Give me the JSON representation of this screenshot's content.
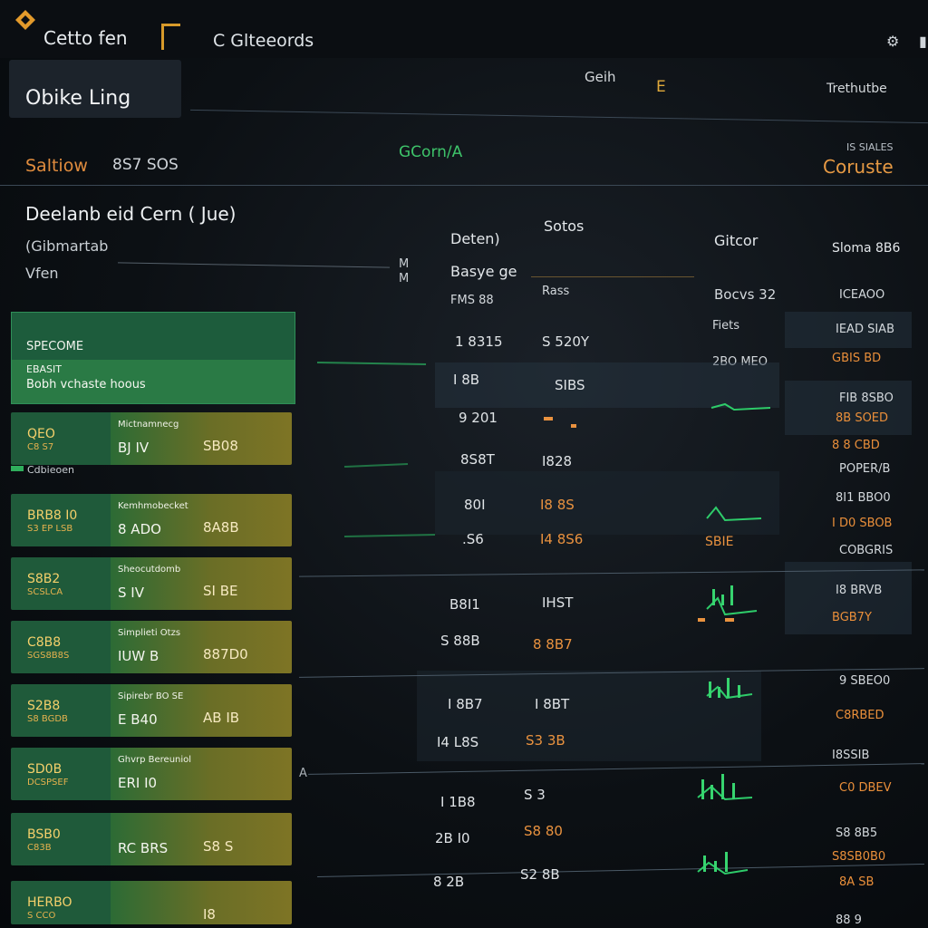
{
  "app": {
    "title": "Cetto fen",
    "nav_tab": "C Glteeords"
  },
  "header": {
    "title": "Obike Ling",
    "center_label": "Geih",
    "center_badge": "E",
    "right_label": "Trethutbe"
  },
  "filters": {
    "label": "Saltiow",
    "value": "8S7 SOS",
    "center": "GCorn/A",
    "right_small": "IS SIALES",
    "right": "Coruste"
  },
  "section": {
    "title": "Deelanb eid Cern ( Jue)",
    "subtitle": "(Gibmartab",
    "view": "Vfen",
    "arrows": [
      "M",
      "M"
    ]
  },
  "columns": {
    "c1_a": "Deten)",
    "c1_b": "Basye ge",
    "c1_c": "FMS 88",
    "c2_a": "Sotos",
    "c2_b": "Rass",
    "c3_a": "Gitcor",
    "c3_b": "Bocvs 32",
    "c3_c": "Fiets",
    "c3_d": "2BO MEO",
    "c4": "Sloma 8B6"
  },
  "hero_card": {
    "label": "SPECOME",
    "sub": "EBASIT",
    "text": "Bobh vchaste hoous"
  },
  "list_cards": [
    {
      "code": "QEO",
      "code2": "C8 S7",
      "desc": "Mictnamnecg",
      "v1": "BJ IV",
      "v2": "SB08"
    },
    {
      "code": "BRB8 I0",
      "code2": "S3 EP LSB",
      "desc": "Kemhmobecket",
      "v1": "8 ADO",
      "v2": "8A8B"
    },
    {
      "code": "S8B2",
      "code2": "SCSLCA",
      "desc": "Sheocutdomb",
      "v1": "S IV",
      "v2": "SI BE"
    },
    {
      "code": "C8B8",
      "code2": "SGS8B8S",
      "desc": "Simplieti Otzs",
      "v1": "IUW B",
      "v2": "887D0"
    },
    {
      "code": "S2B8",
      "code2": "S8 BGDB",
      "desc": "Sipirebr BO SE",
      "v1": "E B40",
      "v2": "AB IB"
    },
    {
      "code": "SD0B",
      "code2": "DCSPSEF",
      "desc": "Ghvrp Bereuniol",
      "v1": "ERI I0",
      "v2": ""
    },
    {
      "code": "BSB0",
      "code2": "C83B",
      "desc": "",
      "v1": "RC BRS",
      "v2": "S8 S"
    },
    {
      "code": "HERBO",
      "code2": "S CCO",
      "desc": "",
      "v1": "",
      "v2": "I8"
    }
  ],
  "list_footer": "Cdbieoen",
  "col_a": [
    "1 8315",
    "I 8B",
    "9 201",
    "8S8T",
    "80I",
    ".S6",
    "B8I1",
    "S 88B",
    "I 8B7",
    "I4 L8S",
    "I 1B8",
    "2B I0",
    "8 2B"
  ],
  "col_b": [
    "S 520Y",
    "SIBS",
    "I828",
    "I8 8S",
    "I4 8S6",
    "IHST",
    "8 8B7",
    "I 8BT",
    "S3 3B",
    "S 3",
    "S8 80",
    "S2 8B"
  ],
  "col_b_accent": [
    false,
    false,
    false,
    true,
    true,
    false,
    true,
    false,
    true,
    false,
    true,
    false
  ],
  "col_c_small": "SBIE",
  "col_d": [
    {
      "t": "ICEAOO",
      "o": false
    },
    {
      "t": "IEAD SIAB",
      "o": false
    },
    {
      "t": "GBIS BD",
      "o": true
    },
    {
      "t": "FIB 8SBO",
      "o": false
    },
    {
      "t": "8B SOED",
      "o": true
    },
    {
      "t": "8 8 CBD",
      "o": true
    },
    {
      "t": "POPER/B",
      "o": false
    },
    {
      "t": "8I1 BBO0",
      "o": false
    },
    {
      "t": "I D0 SBOB",
      "o": true
    },
    {
      "t": "COBGRIS",
      "o": false
    },
    {
      "t": "I8 BRVB",
      "o": false
    },
    {
      "t": "BGB7Y",
      "o": true
    },
    {
      "t": "9 SBEO0",
      "o": false
    },
    {
      "t": "C8RBED",
      "o": true
    },
    {
      "t": "I8SSIB",
      "o": false
    },
    {
      "t": "C0 DBEV",
      "o": true
    },
    {
      "t": "S8 8B5",
      "o": false
    },
    {
      "t": "S8SB0B0",
      "o": true
    },
    {
      "t": "8A SB",
      "o": true
    },
    {
      "t": "88 9",
      "o": false
    }
  ],
  "colors": {
    "accent_green": "#38d46c",
    "accent_orange": "#e9923f",
    "accent_gold": "#e0a93a"
  }
}
